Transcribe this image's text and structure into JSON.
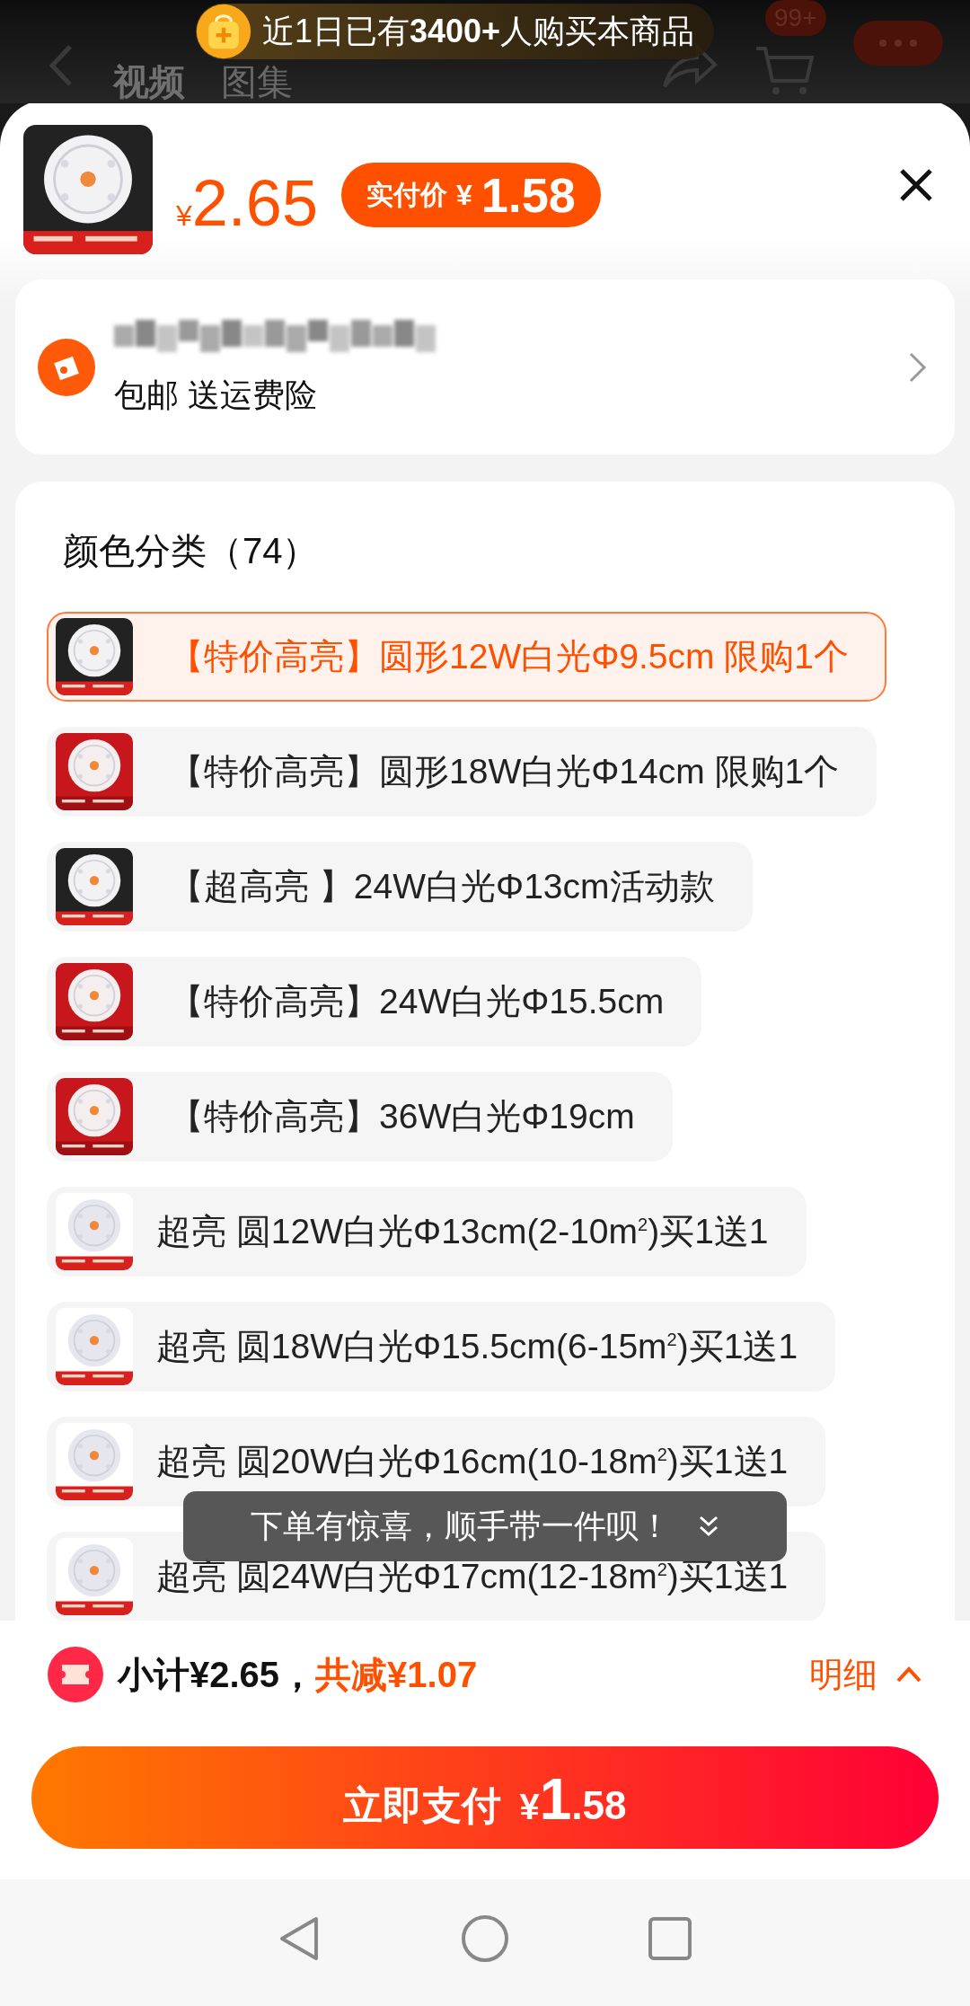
{
  "top_nav": {
    "tabs": [
      {
        "label": "视频",
        "selected": true
      },
      {
        "label": "图集",
        "selected": false
      }
    ],
    "cart_badge": "99+"
  },
  "banner": {
    "text": "近1日已有**3400+**人购买本商品"
  },
  "product": {
    "currency": "¥",
    "price": "2.65",
    "final_price": {
      "label": "实付价",
      "currency": "¥",
      "amount": "1.58"
    }
  },
  "shipping": {
    "text": "包邮 送运费险"
  },
  "options": {
    "title": "颜色分类（74）",
    "items": [
      {
        "label": "【特价高亮】圆形12W白光Φ9.5cm 限购1个",
        "selected": true
      },
      {
        "label": "【特价高亮】圆形18W白光Φ14cm 限购1个",
        "selected": false
      },
      {
        "label": "【超高亮 】24W白光Φ13cm活动款",
        "selected": false
      },
      {
        "label": "【特价高亮】24W白光Φ15.5cm",
        "selected": false
      },
      {
        "label": "【特价高亮】36W白光Φ19cm",
        "selected": false
      },
      {
        "label": "超亮 圆12W白光Φ13cm(2-10m$^{2}$)买1送1",
        "selected": false
      },
      {
        "label": "超亮 圆18W白光Φ15.5cm(6-15m$^{2}$)买1送1",
        "selected": false
      },
      {
        "label": "超亮 圆20W白光Φ16cm(10-18m$^{2}$)买1送1",
        "selected": false
      },
      {
        "label": "超亮 圆24W白光Φ17cm(12-18m$^{2}$)买1送1",
        "selected": false
      }
    ]
  },
  "toast": {
    "text": "下单有惊喜，顺手带一件呗！"
  },
  "summary": {
    "subtotal": "小计¥2.65，",
    "discount": "共减¥1.07",
    "details": "明细"
  },
  "pay_button": {
    "label": "立即支付",
    "currency": "¥",
    "integer": "1",
    "decimals": ".58"
  }
}
